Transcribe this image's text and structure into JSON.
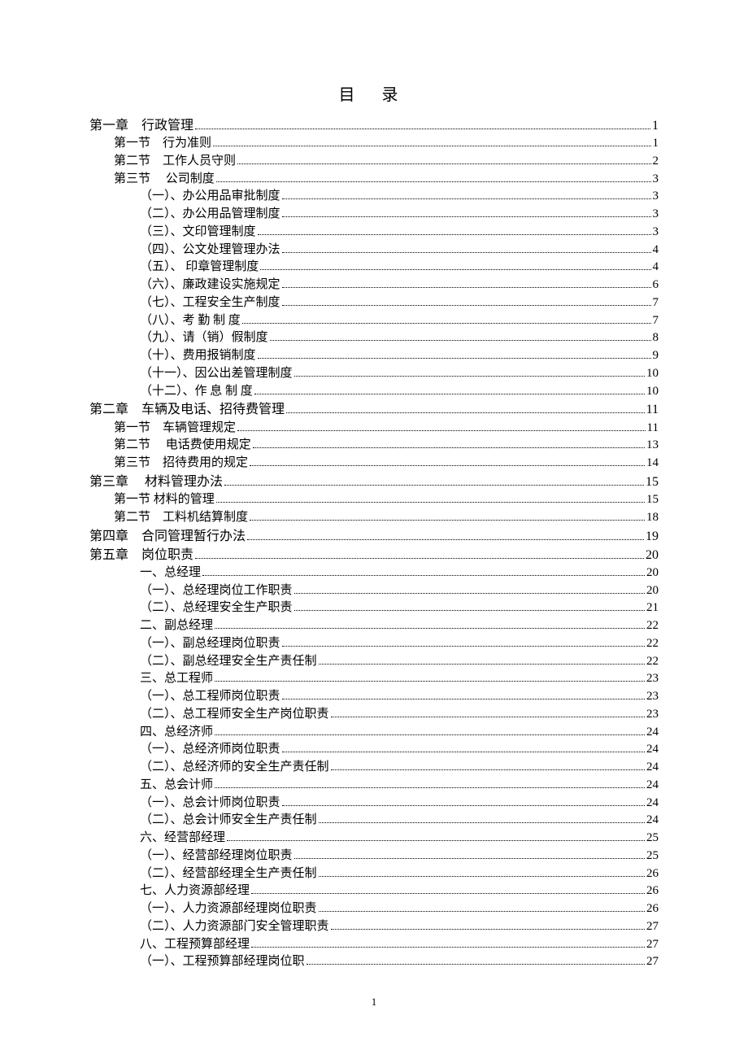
{
  "title": "目 录",
  "pageNumber": "1",
  "entries": [
    {
      "level": 0,
      "label": "第一章　行政管理",
      "page": "1"
    },
    {
      "level": 1,
      "label": "第一节　行为准则",
      "page": "1"
    },
    {
      "level": 1,
      "label": "第二节　工作人员守则",
      "page": "2"
    },
    {
      "level": 1,
      "label": "第三节　 公司制度",
      "page": "3"
    },
    {
      "level": 2,
      "label": "（一）、办公用品审批制度",
      "page": "3"
    },
    {
      "level": 2,
      "label": "（二）、办公用品管理制度",
      "page": "3"
    },
    {
      "level": 2,
      "label": "（三）、文印管理制度",
      "page": "3"
    },
    {
      "level": 2,
      "label": "（四）、公文处理管理办法",
      "page": "4"
    },
    {
      "level": 2,
      "label": "（五）、 印章管理制度",
      "page": "4"
    },
    {
      "level": 2,
      "label": "（六）、廉政建设实施规定",
      "page": "6"
    },
    {
      "level": 2,
      "label": "（七）、工程安全生产制度",
      "page": "7"
    },
    {
      "level": 2,
      "label": "（八）、考 勤 制 度",
      "page": "7"
    },
    {
      "level": 2,
      "label": "（九）、请（销）假制度",
      "page": "8"
    },
    {
      "level": 2,
      "label": "（十）、费用报销制度",
      "page": "9"
    },
    {
      "level": 2,
      "label": "（十一）、因公出差管理制度",
      "page": "10"
    },
    {
      "level": 2,
      "label": "（十二）、作 息 制 度",
      "page": "10"
    },
    {
      "level": 0,
      "label": "第二章　车辆及电话、招待费管理",
      "page": "11"
    },
    {
      "level": 1,
      "label": "第一节　车辆管理规定",
      "page": "11"
    },
    {
      "level": 1,
      "label": "第二节　 电话费使用规定",
      "page": "13"
    },
    {
      "level": 1,
      "label": "第三节　招待费用的规定",
      "page": "14"
    },
    {
      "level": 0,
      "label": "第三章　 材料管理办法",
      "page": "15"
    },
    {
      "level": 1,
      "label": "第一节  材料的管理",
      "page": "15"
    },
    {
      "level": 1,
      "label": "第二节　工料机结算制度",
      "page": "18"
    },
    {
      "level": 0,
      "label": "第四章　合同管理暂行办法",
      "page": "19"
    },
    {
      "level": 0,
      "label": "第五章　岗位职责",
      "page": "20"
    },
    {
      "level": 2,
      "label": "一、总经理",
      "page": "20"
    },
    {
      "level": 2,
      "label": "（一）、总经理岗位工作职责",
      "page": "20"
    },
    {
      "level": 2,
      "label": "（二）、总经理安全生产职责",
      "page": "21"
    },
    {
      "level": 2,
      "label": "二、副总经理",
      "page": "22"
    },
    {
      "level": 2,
      "label": "（一）、副总经理岗位职责",
      "page": "22"
    },
    {
      "level": 2,
      "label": "（二）、副总经理安全生产责任制",
      "page": "22"
    },
    {
      "level": 2,
      "label": "三、总工程师",
      "page": "23"
    },
    {
      "level": 2,
      "label": "（一）、总工程师岗位职责",
      "page": "23"
    },
    {
      "level": 2,
      "label": "（二）、总工程师安全生产岗位职责",
      "page": "23"
    },
    {
      "level": 2,
      "label": "四、总经济师",
      "page": "24"
    },
    {
      "level": 2,
      "label": "（一）、总经济师岗位职责",
      "page": "24"
    },
    {
      "level": 2,
      "label": "（二）、总经济师的安全生产责任制",
      "page": "24"
    },
    {
      "level": 2,
      "label": "五、总会计师",
      "page": "24"
    },
    {
      "level": 2,
      "label": "（一）、总会计师岗位职责",
      "page": "24"
    },
    {
      "level": 2,
      "label": "（二）、总会计师安全生产责任制",
      "page": "24"
    },
    {
      "level": 2,
      "label": "六、经营部经理",
      "page": "25"
    },
    {
      "level": 2,
      "label": "（一）、经营部经理岗位职责",
      "page": "25"
    },
    {
      "level": 2,
      "label": "（二）、经营部经理全生产责任制",
      "page": "26"
    },
    {
      "level": 2,
      "label": "七、人力资源部经理",
      "page": "26"
    },
    {
      "level": 2,
      "label": "（一）、人力资源部经理岗位职责",
      "page": "26"
    },
    {
      "level": 2,
      "label": "（二）、人力资源部门安全管理职责",
      "page": "27"
    },
    {
      "level": 2,
      "label": "八、工程预算部经理",
      "page": "27"
    },
    {
      "level": 2,
      "label": "（一）、工程预算部经理岗位职",
      "page": "27"
    }
  ]
}
